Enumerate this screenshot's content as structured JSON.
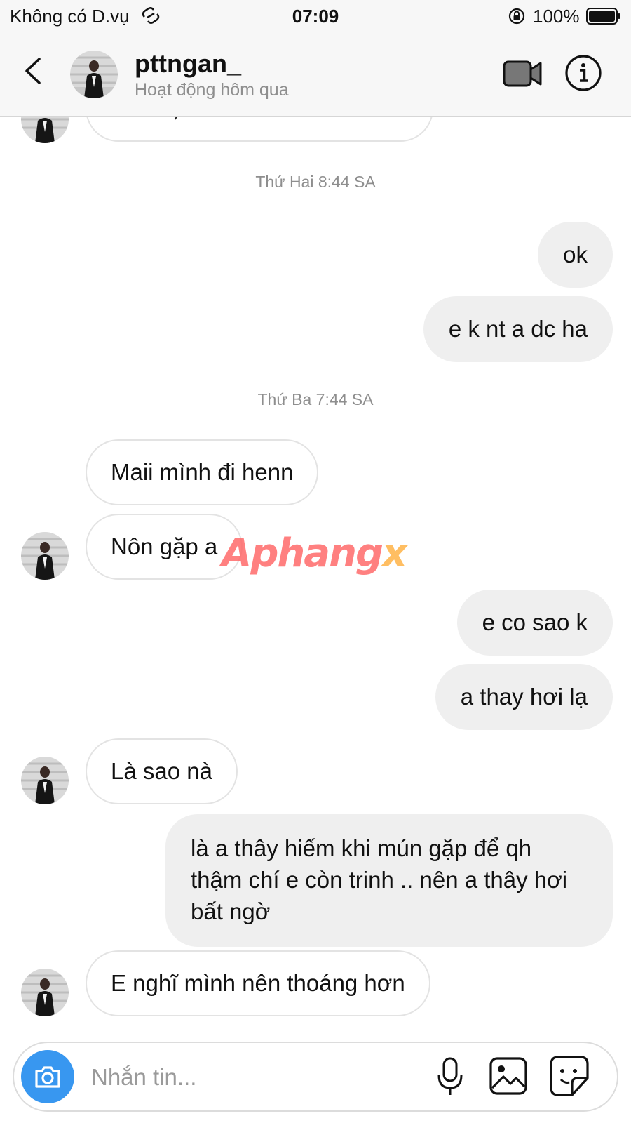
{
  "status_bar": {
    "carrier": "Không có D.vụ",
    "time": "07:09",
    "battery": "100%"
  },
  "header": {
    "username": "pttngan_",
    "activity": "Hoạt động hôm qua"
  },
  "chat": {
    "cut_message": "Nhau , cuối tuần sau há bác",
    "timestamps": [
      "Thứ Hai 8:44 SA",
      "Thứ Ba 7:44 SA"
    ],
    "messages": [
      {
        "from": "me",
        "text": "ok"
      },
      {
        "from": "me",
        "text": "e k nt a dc ha"
      },
      {
        "from": "them",
        "text": "Maii mình đi henn"
      },
      {
        "from": "them",
        "text": "Nôn gặp a"
      },
      {
        "from": "me",
        "text": "e co sao k"
      },
      {
        "from": "me",
        "text": "a thay hơi lạ"
      },
      {
        "from": "them",
        "text": "Là sao nà"
      },
      {
        "from": "me",
        "text": "là a thây hiếm khi mún gặp để qh thậm chí e còn trinh .. nên a thây hơi bất ngờ"
      },
      {
        "from": "them",
        "text": "E nghĩ mình nên thoáng hơn"
      }
    ]
  },
  "watermark": {
    "part1": "Aphang",
    "part2": "x"
  },
  "composer": {
    "placeholder": "Nhắn tin..."
  },
  "icons": {
    "back": "chevron-left-icon",
    "video": "video-camera-icon",
    "info": "info-icon",
    "camera": "camera-icon",
    "mic": "microphone-icon",
    "gallery": "image-icon",
    "sticker": "sticker-icon"
  },
  "colors": {
    "accent": "#3897f0",
    "bubble_out": "#efefef",
    "bubble_in_border": "#e3e3e3",
    "muted_text": "#8e8e8e"
  }
}
